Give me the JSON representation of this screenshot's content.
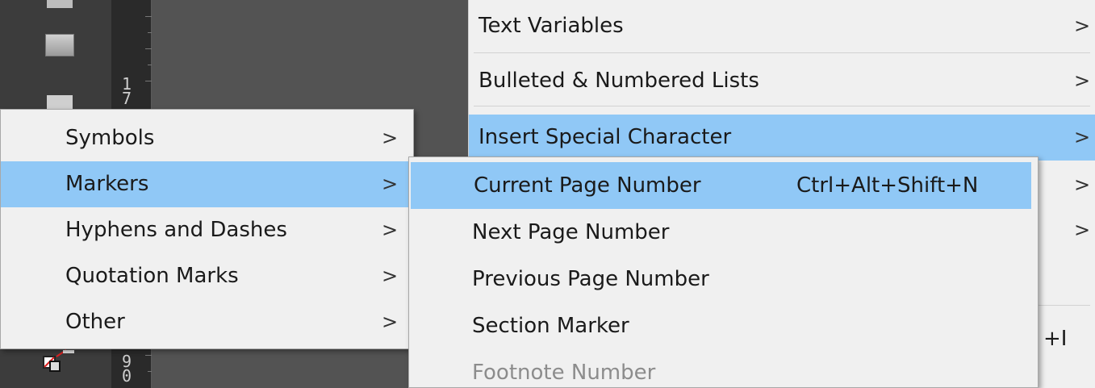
{
  "main_menu": {
    "items": [
      {
        "label": "Text Variables",
        "chevron": ">"
      },
      {
        "label": "Bulleted & Numbered Lists",
        "chevron": ">"
      },
      {
        "label": "Insert Special Character",
        "chevron": ">"
      },
      {
        "label": "",
        "chevron": ">"
      },
      {
        "label": "",
        "chevron": ">"
      }
    ],
    "partial_shortcut": "+I"
  },
  "special_character_menu": {
    "items": [
      {
        "label": "Symbols",
        "chevron": ">"
      },
      {
        "label": "Markers",
        "chevron": ">"
      },
      {
        "label": "Hyphens and Dashes",
        "chevron": ">"
      },
      {
        "label": "Quotation Marks",
        "chevron": ">"
      },
      {
        "label": "Other",
        "chevron": ">"
      }
    ]
  },
  "markers_menu": {
    "items": [
      {
        "label": "Current Page Number",
        "shortcut": "Ctrl+Alt+Shift+N"
      },
      {
        "label": "Next Page Number"
      },
      {
        "label": "Previous Page Number"
      },
      {
        "label": "Section Marker"
      },
      {
        "label": "Footnote Number"
      }
    ]
  },
  "ruler": {
    "numbers": [
      "1",
      "7",
      "9",
      "0"
    ]
  },
  "colors": {
    "highlight": "#90c8f6",
    "menu_bg": "#f0f0f0",
    "panel_bg": "#3c3c3c",
    "disabled_text": "#8c8c8c"
  }
}
